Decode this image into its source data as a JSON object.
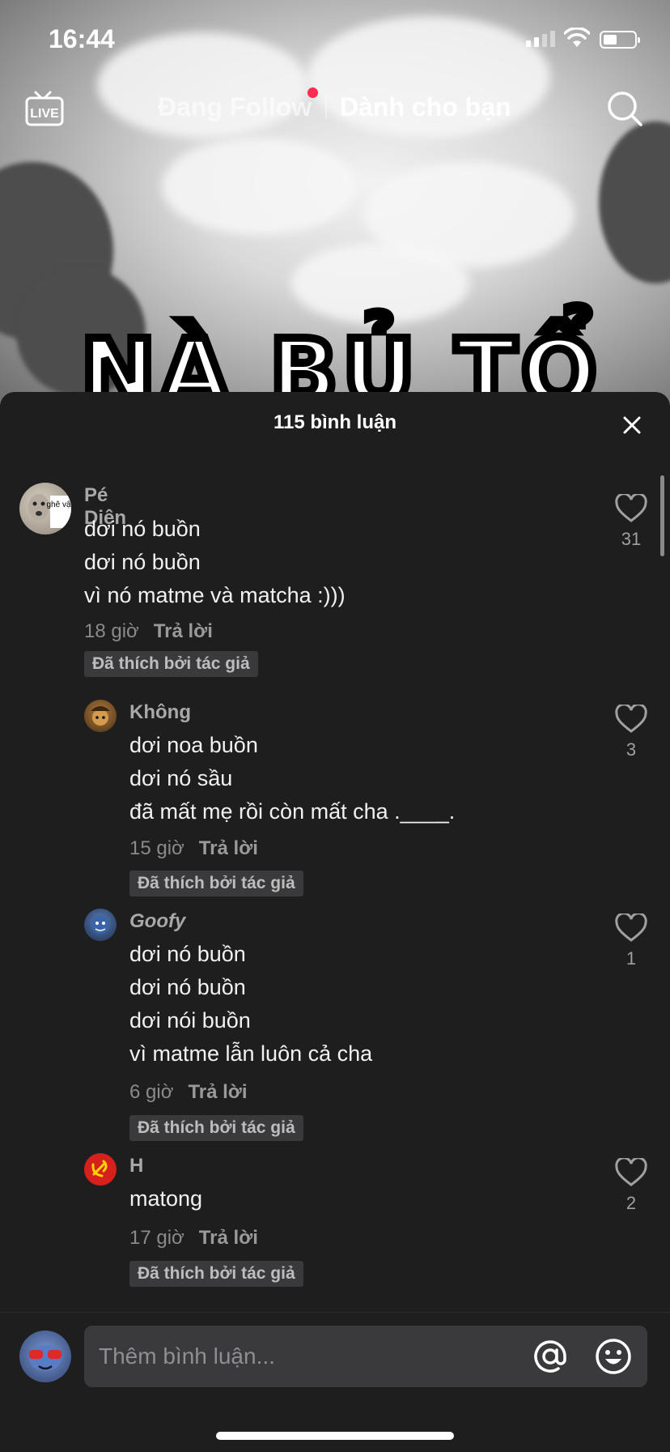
{
  "status_bar": {
    "time": "16:44"
  },
  "top_nav": {
    "tabs": [
      {
        "label": "Đang Follow",
        "active": false,
        "has_notification_dot": true
      },
      {
        "label": "Dành cho bạn",
        "active": true
      }
    ],
    "live_label": "LIVE"
  },
  "video": {
    "title_fragment": "NÀ BỦ TỔ"
  },
  "comments_sheet": {
    "header": "115 bình luận",
    "comments": [
      {
        "username": "Pé Diên",
        "lines": [
          "dơi nó buồn",
          "dơi nó buồn",
          "vì nó matme và matcha :)))"
        ],
        "time": "18 giờ",
        "reply_label": "Trả lời",
        "liked_badge": "Đã thích bởi tác giả",
        "likes": "31",
        "avatar_text": "ghê vậy"
      },
      {
        "username": "Không",
        "lines": [
          "dơi noa buồn",
          "dơi nó sầu",
          "đã mất mẹ rồi còn mất cha .____."
        ],
        "time": "15 giờ",
        "reply_label": "Trả lời",
        "liked_badge": "Đã thích bởi tác giả",
        "likes": "3"
      },
      {
        "username": "Goofy",
        "lines": [
          "dơi nó buồn",
          "dơi nó buồn",
          "dơi nói buồn",
          "vì matme lẫn luôn cả cha"
        ],
        "time": "6 giờ",
        "reply_label": "Trả lời",
        "liked_badge": "Đã thích bởi tác giả",
        "likes": "1"
      },
      {
        "username": "H",
        "lines": [
          "matong"
        ],
        "time": "17 giờ",
        "reply_label": "Trả lời",
        "liked_badge": "Đã thích bởi tác giả",
        "likes": "2"
      }
    ]
  },
  "input": {
    "placeholder": "Thêm bình luận..."
  },
  "colors": {
    "sheet_bg": "#1e1e1f",
    "badge_bg": "#3a3a3c",
    "notification_dot": "#fe2c55"
  },
  "icons": [
    "live-icon",
    "search-icon",
    "close-icon",
    "heart-icon",
    "mention-icon",
    "emoji-icon"
  ]
}
